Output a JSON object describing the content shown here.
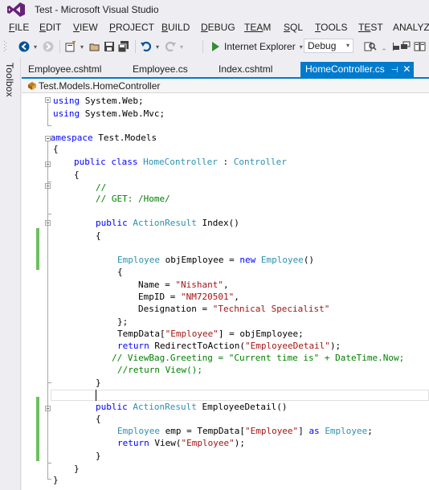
{
  "window": {
    "title": "Test - Microsoft Visual Studio"
  },
  "menu": [
    {
      "u": "F",
      "rest": "ILE"
    },
    {
      "u": "E",
      "rest": "DIT"
    },
    {
      "u": "V",
      "rest": "IEW"
    },
    {
      "u": "P",
      "rest": "ROJECT"
    },
    {
      "u": "B",
      "rest": "UILD"
    },
    {
      "u": "D",
      "rest": "EBUG"
    },
    {
      "u": "",
      "rest": "TEAM"
    },
    {
      "u": "S",
      "rest": "QL"
    },
    {
      "u": "T",
      "rest": "OOLS"
    },
    {
      "u": "",
      "rest": "TEST"
    },
    {
      "u": "",
      "rest": "ANALYZE"
    }
  ],
  "toolbar": {
    "run_label": "Internet Explorer",
    "config_value": "Debug"
  },
  "toolbox": {
    "label": "Toolbox"
  },
  "tabs": [
    {
      "label": "Employee.cshtml"
    },
    {
      "label": "Employee.cs"
    },
    {
      "label": "Index.cshtml"
    },
    {
      "label": "HomeController.cs",
      "active": true
    }
  ],
  "navbar": {
    "path": "Test.Models.HomeController"
  },
  "code": [
    [
      [
        "kw",
        "using"
      ],
      [
        "",
        "System.Web;"
      ]
    ],
    [
      [
        "kw",
        "using"
      ],
      [
        "",
        "System.Web.Mvc;"
      ]
    ],
    [],
    [
      [
        "kw",
        "namespace"
      ],
      [
        "",
        " Test.Models"
      ]
    ],
    [
      [
        "",
        "{"
      ]
    ],
    [
      [
        "kw",
        "public class"
      ],
      [
        "",
        " "
      ],
      [
        "ty",
        "HomeController"
      ],
      [
        "",
        " : "
      ],
      [
        "ty",
        "Controller"
      ]
    ],
    [
      [
        "",
        "{"
      ]
    ],
    [
      [
        "cm",
        "//"
      ]
    ],
    [
      [
        "cm",
        "// GET: /Home/"
      ]
    ],
    [],
    [
      [
        "kw",
        "public"
      ],
      [
        "",
        " "
      ],
      [
        "ty",
        "ActionResult"
      ],
      [
        "",
        " Index()"
      ]
    ],
    [
      [
        "",
        "{"
      ]
    ],
    [],
    [
      [
        "ty",
        "Employee"
      ],
      [
        "",
        " objEmployee = "
      ],
      [
        "kw",
        "new"
      ],
      [
        "",
        " "
      ],
      [
        "ty",
        "Employee"
      ],
      [
        "",
        "()"
      ]
    ],
    [
      [
        "",
        "{"
      ]
    ],
    [
      [
        "",
        "Name = "
      ],
      [
        "str",
        "\"Nishant\""
      ],
      [
        "",
        ","
      ]
    ],
    [
      [
        "",
        "EmpID = "
      ],
      [
        "str",
        "\"NM720501\""
      ],
      [
        "",
        ","
      ]
    ],
    [
      [
        "",
        "Designation = "
      ],
      [
        "str",
        "\"Technical Specialist\""
      ]
    ],
    [
      [
        "",
        "};"
      ]
    ],
    [
      [
        "",
        "TempData["
      ],
      [
        "str",
        "\"Employee\""
      ],
      [
        "",
        "] = objEmployee;"
      ]
    ],
    [
      [
        "kw",
        "return"
      ],
      [
        "",
        " RedirectToAction("
      ],
      [
        "str",
        "\"EmployeeDetail\""
      ],
      [
        "",
        ");"
      ]
    ],
    [
      [
        "cm",
        "// ViewBag.Greeting = \"Current time is\" + DateTime.Now;"
      ]
    ],
    [
      [
        "cm",
        "//return View();"
      ]
    ],
    [
      [
        "",
        "}"
      ]
    ],
    [],
    [
      [
        "kw",
        "public"
      ],
      [
        "",
        " "
      ],
      [
        "ty",
        "ActionResult"
      ],
      [
        "",
        " EmployeeDetail()"
      ]
    ],
    [
      [
        "",
        "{"
      ]
    ],
    [
      [
        "ty",
        "Employee"
      ],
      [
        "",
        " emp = TempData["
      ],
      [
        "str",
        "\"Employee\""
      ],
      [
        "",
        "] "
      ],
      [
        "kw",
        "as"
      ],
      [
        "",
        " "
      ],
      [
        "ty",
        "Employee"
      ],
      [
        "",
        ";"
      ]
    ],
    [
      [
        "kw",
        "return"
      ],
      [
        "",
        " View("
      ],
      [
        "str",
        "\"Employee\""
      ],
      [
        "",
        ");"
      ]
    ],
    [
      [
        "",
        "}"
      ]
    ],
    [
      [
        "",
        "}"
      ]
    ],
    [
      [
        "",
        "}"
      ]
    ]
  ]
}
